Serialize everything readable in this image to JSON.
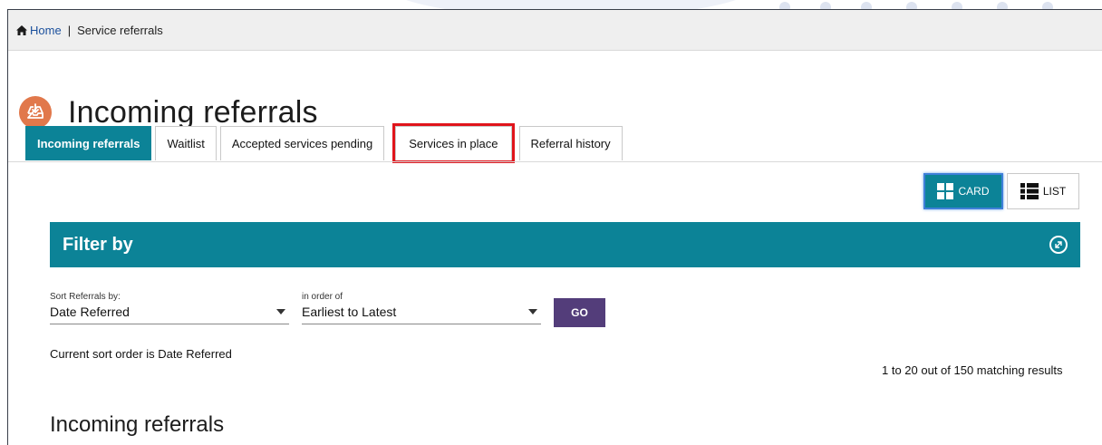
{
  "breadcrumb": {
    "home_label": "Home",
    "separator": "|",
    "current": "Service referrals"
  },
  "page": {
    "title": "Incoming referrals",
    "icon": "inbox-download-icon",
    "accent_color": "#e1784b"
  },
  "tabs": [
    {
      "label": "Incoming referrals",
      "active": true
    },
    {
      "label": "Waitlist",
      "active": false
    },
    {
      "label": "Accepted services pending",
      "active": false
    },
    {
      "label": "Services in place",
      "active": false,
      "highlighted": true
    },
    {
      "label": "Referral history",
      "active": false
    }
  ],
  "view_toggle": {
    "card_label": "CARD",
    "list_label": "LIST",
    "selected": "CARD"
  },
  "filter": {
    "title": "Filter by",
    "sort_by": {
      "label": "Sort Referrals by:",
      "value": "Date Referred"
    },
    "order": {
      "label": "in order of",
      "value": "Earliest to Latest"
    },
    "go_label": "GO"
  },
  "status": {
    "sort_order_text": "Current sort order is Date Referred",
    "results_text": "1 to 20 out of 150 matching results"
  },
  "section": {
    "title": "Incoming referrals"
  },
  "colors": {
    "teal": "#0c8397",
    "go_purple": "#533d7a",
    "highlight_red": "#e0141b",
    "link_blue": "#1a4f9c"
  }
}
